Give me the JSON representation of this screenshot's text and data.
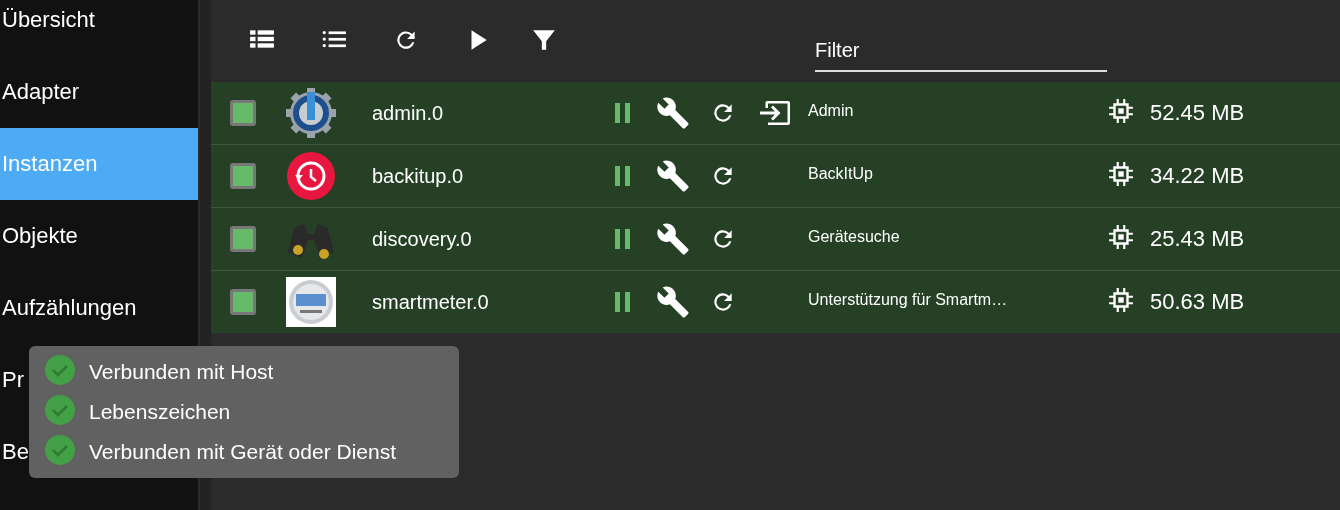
{
  "sidebar": {
    "items": [
      {
        "label": "Übersicht",
        "selected": false
      },
      {
        "label": "Adapter",
        "selected": false
      },
      {
        "label": "Instanzen",
        "selected": true
      },
      {
        "label": "Objekte",
        "selected": false
      },
      {
        "label": "Aufzählungen",
        "selected": false
      },
      {
        "label": "Pr",
        "selected": false
      },
      {
        "label": "Be",
        "selected": false
      }
    ]
  },
  "toolbar": {
    "filter": {
      "placeholder": "Filter"
    }
  },
  "instances": [
    {
      "kind": "gear",
      "name": "admin.0",
      "connected": true,
      "running": true,
      "link": true,
      "title": "Admin",
      "memory": "52.45 MB"
    },
    {
      "kind": "backup",
      "name": "backitup.0",
      "connected": true,
      "running": true,
      "link": false,
      "title": "BackItUp",
      "memory": "34.22 MB"
    },
    {
      "kind": "binoculars",
      "name": "discovery.0",
      "connected": true,
      "running": true,
      "link": false,
      "title": "Gerätesuche",
      "memory": "25.43 MB"
    },
    {
      "kind": "meter",
      "name": "smartmeter.0",
      "connected": true,
      "running": true,
      "link": false,
      "title": "Unterstützung für Smartm…",
      "memory": "50.63 MB"
    }
  ],
  "tooltip": {
    "items": [
      {
        "label": "Verbunden mit Host",
        "ok": true
      },
      {
        "label": "Lebenszeichen",
        "ok": true
      },
      {
        "label": "Verbunden mit Gerät oder Dienst",
        "ok": true
      }
    ]
  }
}
